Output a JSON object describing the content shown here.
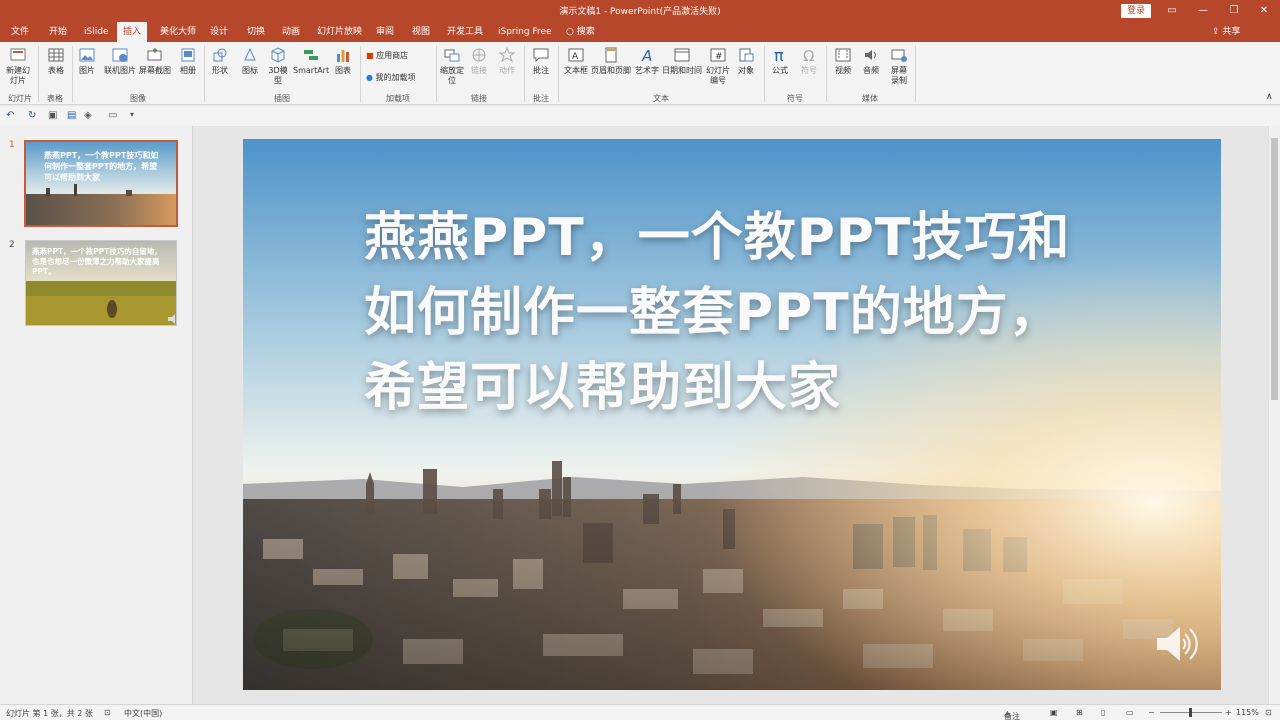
{
  "window": {
    "title": "演示文稿1  -  PowerPoint(产品激活失败)",
    "login_label": "登录",
    "controls": {
      "ribbon_display": "▭",
      "minimize": "—",
      "maximize": "❐",
      "close": "✕"
    }
  },
  "tabs": [
    {
      "label": "文件"
    },
    {
      "label": "开始"
    },
    {
      "label": "iSlide"
    },
    {
      "label": "插入"
    },
    {
      "label": "美化大师"
    },
    {
      "label": "设计"
    },
    {
      "label": "切换"
    },
    {
      "label": "动画"
    },
    {
      "label": "幻灯片放映"
    },
    {
      "label": "审阅"
    },
    {
      "label": "视图"
    },
    {
      "label": "开发工具"
    },
    {
      "label": "iSpring Free"
    },
    {
      "label": "搜索"
    }
  ],
  "share_label": "共享",
  "ribbon": {
    "buttons": {
      "new_slide": "新建幻灯片",
      "table": "表格",
      "picture": "图片",
      "online_picture": "联机图片",
      "screenshot": "屏幕截图",
      "album": "相册",
      "shape": "形状",
      "icon": "图标",
      "model3d": "3D模型",
      "smartart": "SmartArt",
      "chart": "图表",
      "app_store": "应用商店",
      "my_addins": "我的加载项",
      "zoom": "缩放定位",
      "link": "链接",
      "action": "动作",
      "comment": "批注",
      "textbox": "文本框",
      "header_footer": "页眉和页脚",
      "wordart": "艺术字",
      "datetime": "日期和时间",
      "slide_number": "幻灯片编号",
      "object": "对象",
      "equation": "公式",
      "symbol": "符号",
      "video": "视频",
      "audio": "音频",
      "screen_record": "屏幕录制"
    },
    "groups": {
      "slides": "幻灯片",
      "tables": "表格",
      "images": "图像",
      "illustrations": "插图",
      "addins": "加载项",
      "links": "链接",
      "comments": "批注",
      "text": "文本",
      "symbols": "符号",
      "media": "媒体"
    }
  },
  "slides": [
    {
      "number": "1",
      "thumb_text": "燕燕PPT，一个教PPT技巧和如何制作一整套PPT的地方，希望可以帮助到大家"
    },
    {
      "number": "2",
      "thumb_text": "燕燕PPT，一个教PPT技巧的自留地，也是也想尽一份微薄之力帮助大家提高PPT。"
    }
  ],
  "slide": {
    "title": "燕燕PPT，一个教PPT技巧和如何制作一整套PPT的地方，希望可以帮助到大家"
  },
  "status": {
    "slide_info": "幻灯片 第 1 张，共 2 张",
    "language": "中文(中国)",
    "notes": "备注",
    "zoom": "115%"
  }
}
